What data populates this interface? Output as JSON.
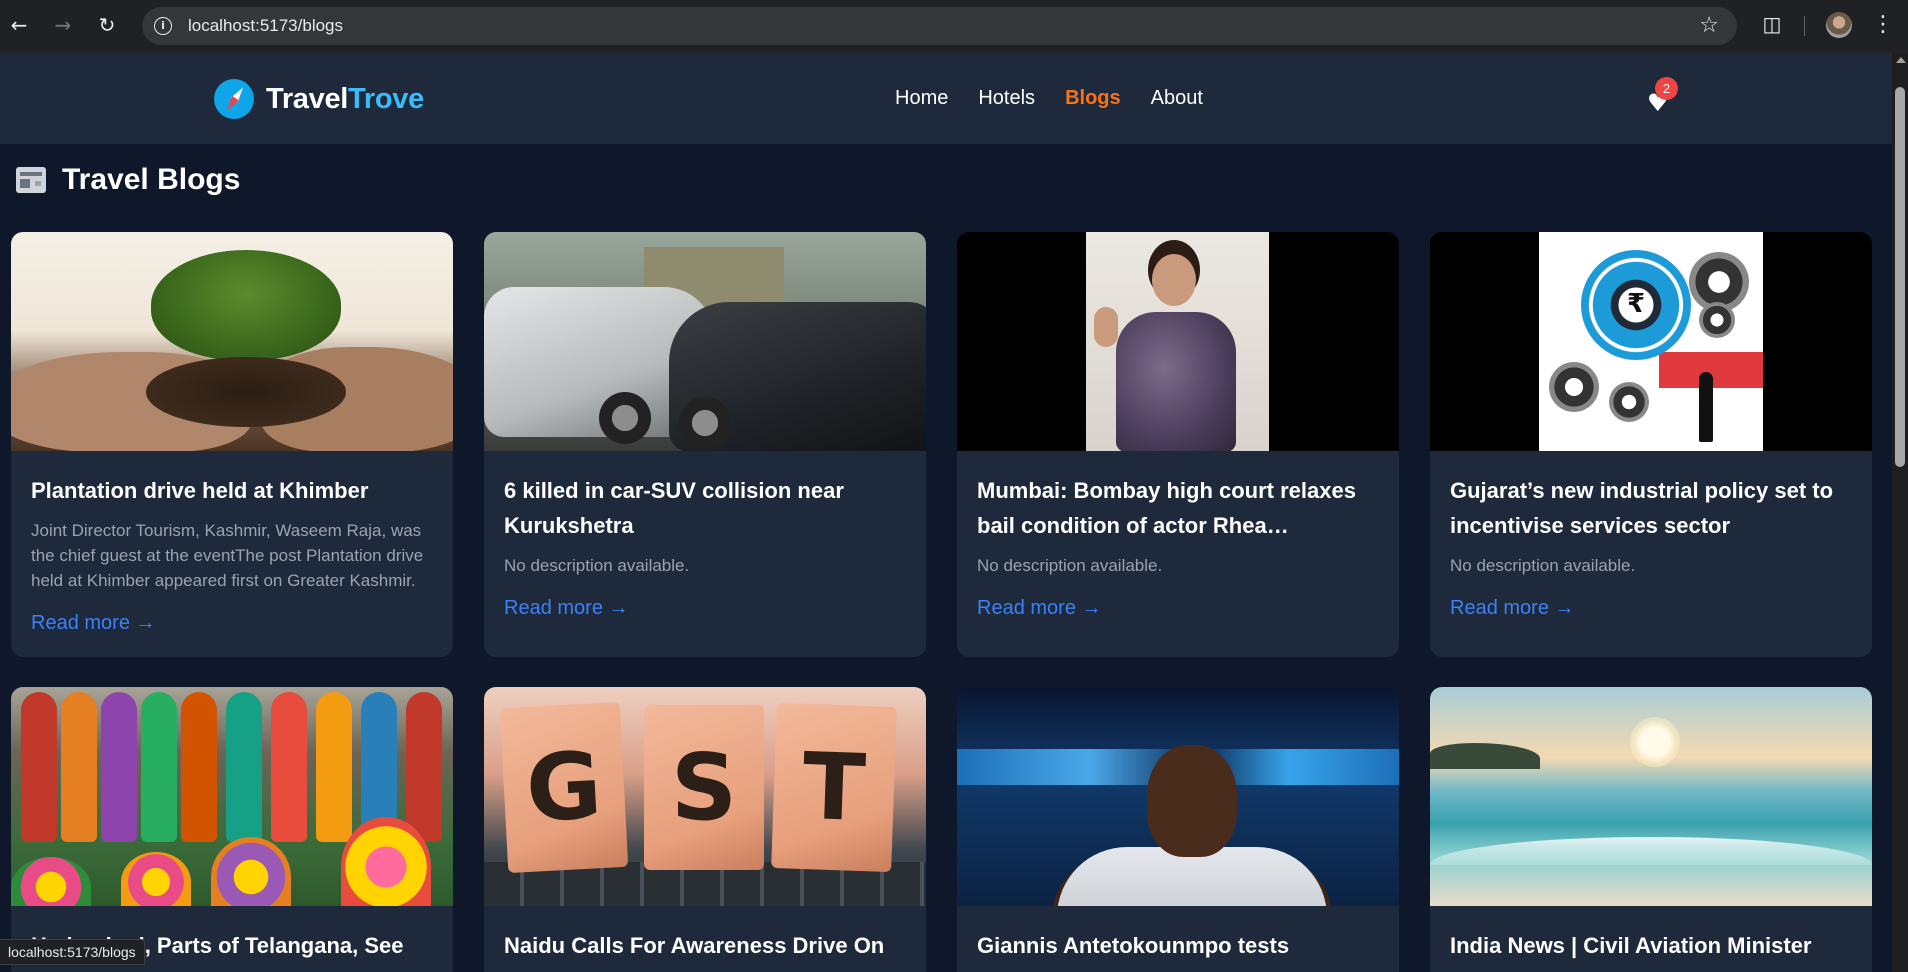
{
  "browser": {
    "url": "localhost:5173/blogs",
    "back_icon": "arrow-left",
    "forward_icon": "arrow-right",
    "reload_icon": "reload",
    "bookmark_icon": "star",
    "extensions_icon": "puzzle",
    "menu_icon": "kebab",
    "status_url": "localhost:5173/blogs"
  },
  "site": {
    "logo_part1": "Travel",
    "logo_part2": "Trove",
    "nav": [
      {
        "label": "Home",
        "active": false
      },
      {
        "label": "Hotels",
        "active": false
      },
      {
        "label": "Blogs",
        "active": true
      },
      {
        "label": "About",
        "active": false
      }
    ],
    "wishlist_count": "2",
    "accent_color": "#f97316",
    "brand_color": "#38bdf8"
  },
  "page": {
    "title": "Travel Blogs",
    "title_icon": "newspaper"
  },
  "cards": [
    {
      "title": "Plantation drive held at Khimber",
      "description": "Joint Director Tourism, Kashmir, Waseem Raja, was the chief guest at the eventThe post Plantation drive held at Khimber appeared first on Greater Kashmir.",
      "link": "Read more →",
      "image": "hands holding soil with small tree"
    },
    {
      "title": "6 killed in car-SUV collision near Kurukshetra",
      "description": "No description available.",
      "link": "Read more →",
      "image": "crashed cars"
    },
    {
      "title": "Mumbai: Bombay high court relaxes bail condition of actor Rhea Chakraborty",
      "description": "No description available.",
      "link": "Read more →",
      "image": "woman waving"
    },
    {
      "title": "Gujarat’s new industrial policy set to incentivise services sector",
      "description": "No description available.",
      "link": "Read more →",
      "image": "gears with rupee symbol"
    },
    {
      "title": "Hyderabad, Parts of Telangana, See",
      "description": "",
      "link": "",
      "image": "women in saris with flower arrangements"
    },
    {
      "title": "Naidu Calls For Awareness Drive On",
      "description": "",
      "link": "",
      "image": "GST wooden blocks"
    },
    {
      "title": "Giannis Antetokounmpo tests",
      "description": "",
      "link": "",
      "image": "basketball player"
    },
    {
      "title": "India News | Civil Aviation Minister",
      "description": "",
      "link": "",
      "image": "beach at sunset"
    }
  ]
}
